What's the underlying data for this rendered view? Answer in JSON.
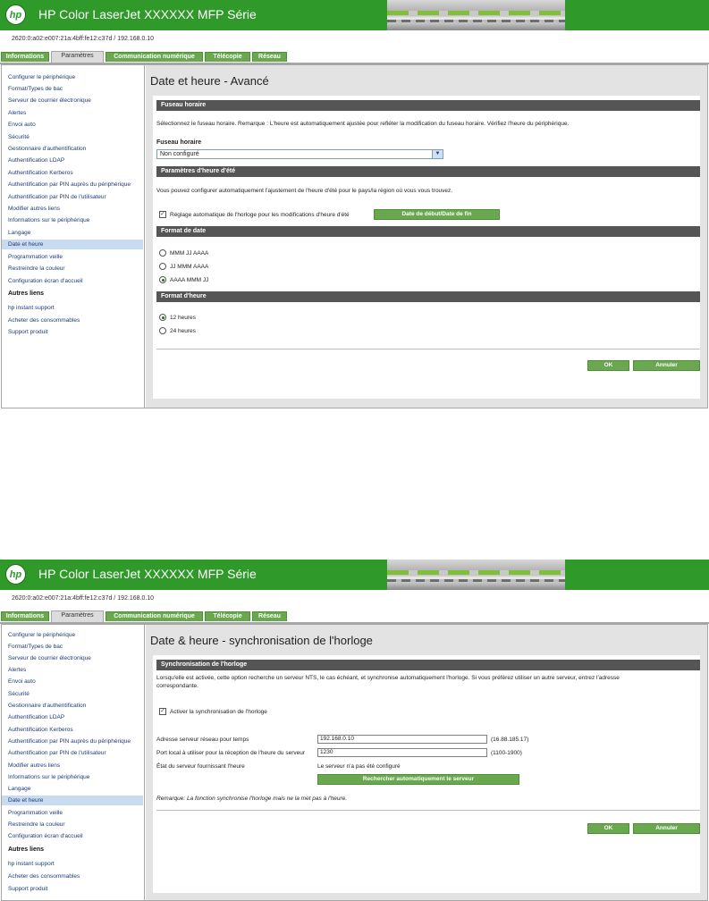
{
  "common": {
    "banner_title": "HP Color LaserJet XXXXXX MFP Série",
    "address": "2620:0:a02:e007:21a:4bff:fe12:c37d / 192.168.0.10",
    "tabs": [
      "Informations",
      "Paramètres",
      "Communication numérique",
      "Télécopie",
      "Réseau"
    ],
    "active_tab": "Paramètres",
    "sidebar_items": [
      "Configurer le périphérique",
      "Format/Types de bac",
      "Serveur de courrier électronique",
      "Alertes",
      "Envoi auto",
      "Sécurité",
      "Gestionnaire d'authentification",
      "Authentification LDAP",
      "Authentification Kerberos",
      "Authentification par PIN auprès du périphérique",
      "Authentification par PIN de l'utilisateur",
      "Modifier autres liens",
      "Informations sur le périphérique",
      "Langage",
      "Date et heure",
      "Programmation veille",
      "Restreindre la couleur",
      "Configuration écran d'accueil"
    ],
    "selected_sidebar_item": "Date et heure",
    "other_links_heading": "Autres liens",
    "other_links": [
      "hp instant support",
      "Acheter des consommables",
      "Support produit"
    ],
    "ok_label": "OK",
    "cancel_label": "Annuler"
  },
  "screen1": {
    "page_title": "Date et heure - Avancé",
    "timezone_section": "Fuseau horaire",
    "timezone_description": "Sélectionnez le fuseau horaire. Remarque : L'heure est automatiquement ajustée pour refléter la modification du fuseau horaire. Vérifiez l'heure du périphérique.",
    "timezone_label": "Fuseau horaire",
    "timezone_value": "Non configuré",
    "dst_section": "Paramètres d'heure d'été",
    "dst_description": "Vous pouvez configurer automatiquement l'ajustement de l'heure d'été pour le pays/la région où vous vous trouvez.",
    "dst_checkbox_label": "Réglage automatique de l'horloge pour les modifications d'heure d'été",
    "dst_checked": true,
    "dst_button": "Date de début/Date de fin",
    "date_format_section": "Format de date",
    "date_formats": [
      "MMM JJ AAAA",
      "JJ MMM AAAA",
      "AAAA MMM JJ"
    ],
    "date_format_selected": "AAAA MMM JJ",
    "time_format_section": "Format d'heure",
    "time_formats": [
      "12 heures",
      "24 heures"
    ],
    "time_format_selected": "12 heures"
  },
  "screen2": {
    "page_title": "Date & heure - synchronisation de l'horloge",
    "sync_section": "Synchronisation de l'horloge",
    "sync_description_1": "Lorsqu'elle est activée, cette option recherche un serveur NTS, le cas échéant, et synchronise automatiquement l'horloge. Si vous préférez utiliser un autre serveur, entrez l'adresse",
    "sync_description_2": "correspondante.",
    "enable_sync_label": "Activer la synchronisation de l'horloge",
    "enable_sync_checked": true,
    "server_address_label": "Adresse serveur réseau pour temps",
    "server_address_value": "192.168.0.10",
    "server_address_hint": "(16.88.185.17)",
    "local_port_label": "Port local à utiliser pour la réception de l'heure du serveur",
    "local_port_value": "1230",
    "local_port_hint": "(1100-1900)",
    "server_state_label": "État du serveur fournissant l'heure",
    "server_state_value": "Le serveur n'a pas été configuré",
    "auto_search_button": "Rechercher automatiquement le serveur",
    "remark": "Remarque: La fonction synchronise l'horloge mais ne la met pas à l'heure."
  }
}
